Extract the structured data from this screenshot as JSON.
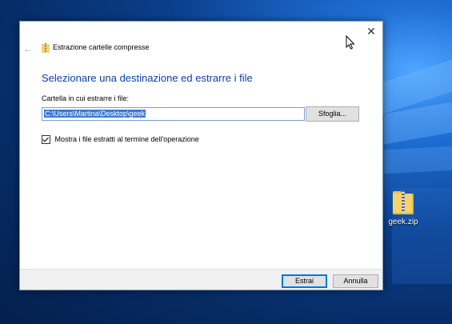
{
  "desktop": {
    "icon_label": "geek.zip"
  },
  "dialog": {
    "title": "Estrazione cartelle compresse",
    "heading": "Selezionare una destinazione ed estrarre i file",
    "path_label": "Cartella in cui estrarre i file:",
    "path_value": "C:\\Users\\Martina\\Desktop\\geek",
    "browse_label": "Sfoglia...",
    "show_files_label": "Mostra i file estratti al termine dell'operazione",
    "show_files_checked": true,
    "extract_label": "Estrai",
    "cancel_label": "Annulla",
    "close_glyph": "✕",
    "back_glyph": "←"
  },
  "icons": {
    "zip": "zip-folder-icon",
    "cursor": "mouse-cursor-icon"
  },
  "colors": {
    "heading": "#0b3fa1",
    "selection": "#3a7bd5",
    "accent": "#0078d7"
  }
}
